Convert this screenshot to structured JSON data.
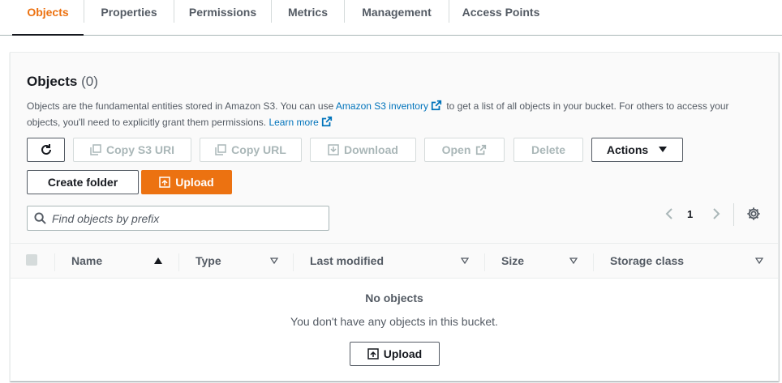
{
  "tabs": [
    {
      "label": "Objects",
      "active": true
    },
    {
      "label": "Properties"
    },
    {
      "label": "Permissions"
    },
    {
      "label": "Metrics"
    },
    {
      "label": "Management"
    },
    {
      "label": "Access Points"
    }
  ],
  "section": {
    "title": "Objects",
    "count": "(0)",
    "description": {
      "part1": "Objects are the fundamental entities stored in Amazon S3. You can use",
      "link1": "Amazon S3 inventory",
      "part2": "to get a list of all objects in your bucket. For others to access your objects, you'll need to explicitly grant them permissions.",
      "link2": "Learn more"
    }
  },
  "toolbar": {
    "refresh_icon": "refresh-icon",
    "copy_s3_uri": "Copy S3 URI",
    "copy_url": "Copy URL",
    "download": "Download",
    "open": "Open",
    "delete": "Delete",
    "actions": "Actions",
    "create_folder": "Create folder",
    "upload": "Upload"
  },
  "search": {
    "placeholder": "Find objects by prefix",
    "value": ""
  },
  "pagination": {
    "current_page": "1"
  },
  "table": {
    "columns": [
      "Name",
      "Type",
      "Last modified",
      "Size",
      "Storage class"
    ],
    "rows": [],
    "empty_title": "No objects",
    "empty_description": "You don't have any objects in this bucket.",
    "empty_upload": "Upload"
  },
  "colors": {
    "accent": "#ec7211",
    "link": "#0073bb",
    "text": "#16191f",
    "muted": "#545b64",
    "disabled": "#aab7b8"
  }
}
